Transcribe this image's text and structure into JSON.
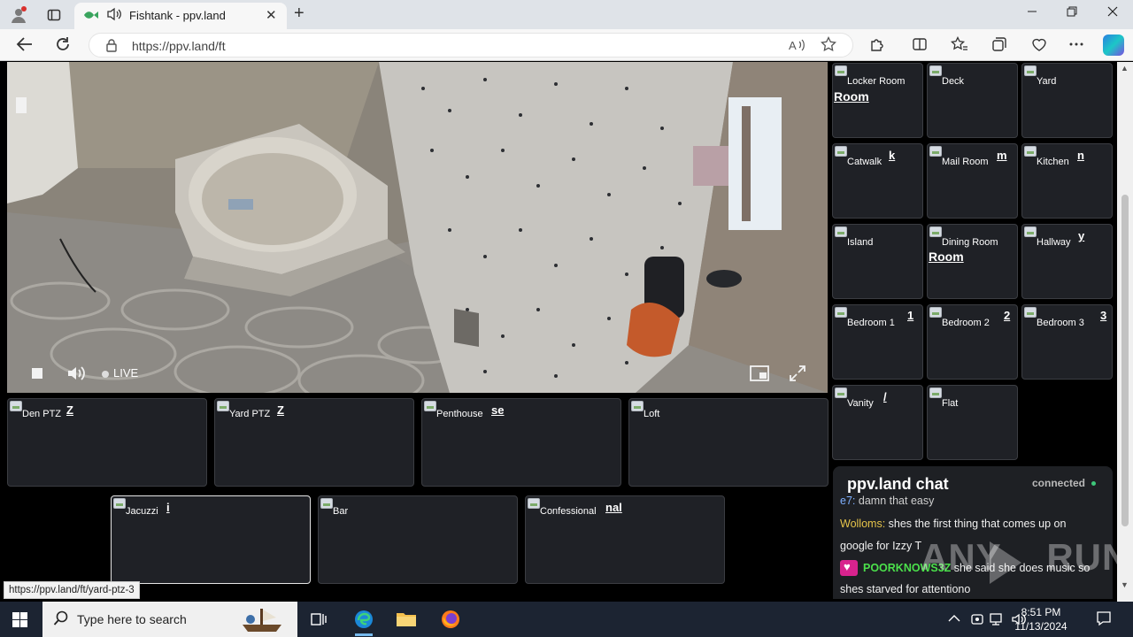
{
  "browser": {
    "tab_title": "Fishtank - ppv.land",
    "url": "https://ppv.land/ft",
    "tab_close": "✕",
    "new_tab": "+"
  },
  "video": {
    "live_label": "LIVE"
  },
  "cams_main": [
    {
      "label": "Den PTZ",
      "ghost": "Z"
    },
    {
      "label": "Yard PTZ",
      "ghost": "Z"
    },
    {
      "label": "Penthouse",
      "ghost": "se"
    },
    {
      "label": "Loft",
      "ghost": ""
    }
  ],
  "cams_lower": [
    {
      "label": "Jacuzzi",
      "ghost": "i"
    },
    {
      "label": "Bar",
      "ghost": ""
    },
    {
      "label": "Confessional",
      "ghost": "nal"
    }
  ],
  "cams_side": [
    {
      "label": "Locker Room",
      "ghost": "Room"
    },
    {
      "label": "Deck",
      "ghost": ""
    },
    {
      "label": "Yard",
      "ghost": ""
    },
    {
      "label": "Catwalk",
      "ghost": "k"
    },
    {
      "label": "Mail Room",
      "ghost": "m"
    },
    {
      "label": "Kitchen",
      "ghost": "n"
    },
    {
      "label": "Island",
      "ghost": ""
    },
    {
      "label": "Dining Room",
      "ghost": "Room"
    },
    {
      "label": "Hallway",
      "ghost": "y"
    },
    {
      "label": "Bedroom 1",
      "ghost": "1"
    },
    {
      "label": "Bedroom 2",
      "ghost": "2"
    },
    {
      "label": "Bedroom 3",
      "ghost": "3"
    },
    {
      "label": "Vanity",
      "ghost": "/"
    },
    {
      "label": "Flat",
      "ghost": ""
    }
  ],
  "chat": {
    "title": "ppv.land chat",
    "status": "connected",
    "lines": [
      {
        "user": "",
        "text": "damn that easy",
        "color": "#cfcfcf"
      },
      {
        "user": "Wolloms:",
        "text": "shes the first thing that comes up on",
        "color": "#e6c44a"
      },
      {
        "user": "",
        "text": "google for Izzy T",
        "color": ""
      },
      {
        "user": "POORKNOWS3Z",
        "text": "she said she does music so",
        "color": "#4be04b"
      },
      {
        "user": "",
        "text": "shes starved for attentiono",
        "color": ""
      }
    ]
  },
  "status_url": "https://ppv.land/ft/yard-ptz-3",
  "watermark": "ANY RUN",
  "taskbar": {
    "search_placeholder": "Type here to search",
    "time": "8:51 PM",
    "date": "11/13/2024"
  }
}
